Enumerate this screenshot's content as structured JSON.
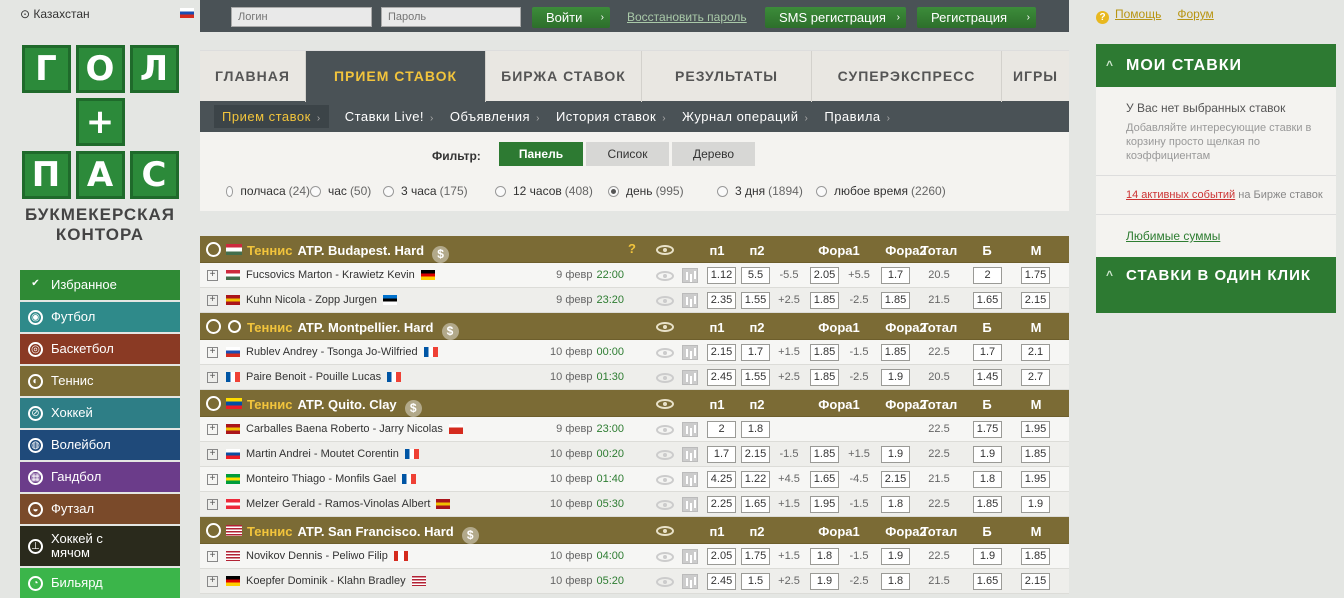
{
  "topbar": {
    "location": "⊙ Казахстан",
    "login_placeholder": "Логин",
    "password_placeholder": "Пароль",
    "login_button": "Войти",
    "restore_link": "Восстановить пароль",
    "sms_button": "SMS регистрация",
    "register_button": "Регистрация",
    "help_link": "Помощь",
    "forum_link": "Форум",
    "arrow": "›"
  },
  "logo": {
    "row1": [
      "Г",
      "О",
      "Л"
    ],
    "row2": [
      "+"
    ],
    "row3": [
      "П",
      "А",
      "С"
    ],
    "caption1": "БУКМЕКЕРСКАЯ",
    "caption2": "КОНТОРА"
  },
  "sports": [
    {
      "label": "Избранное",
      "icon": "✔",
      "color": "#2f8a35"
    },
    {
      "label": "Футбол",
      "icon": "◉",
      "color": "#2f8a8a"
    },
    {
      "label": "Баскетбол",
      "icon": "◎",
      "color": "#8a3a24"
    },
    {
      "label": "Теннис",
      "icon": "◐",
      "color": "#7b6b35"
    },
    {
      "label": "Хоккей",
      "icon": "⊘",
      "color": "#2e7e86"
    },
    {
      "label": "Волейбол",
      "icon": "◍",
      "color": "#1f4a7a"
    },
    {
      "label": "Гандбол",
      "icon": "▦",
      "color": "#6b3c8a"
    },
    {
      "label": "Футзал",
      "icon": "◒",
      "color": "#7a4a2a"
    },
    {
      "label": "Хоккей с мячом",
      "icon": "⊥",
      "color": "#2a2a1c"
    },
    {
      "label": "Бильярд",
      "icon": "◔",
      "color": "#3bb54a"
    }
  ],
  "tabs": [
    "ГЛАВНАЯ",
    "ПРИЕМ СТАВОК",
    "БИРЖА СТАВОК",
    "РЕЗУЛЬТАТЫ",
    "СУПЕРЭКСПРЕСС",
    "ИГРЫ"
  ],
  "subnav": [
    "Прием ставок",
    "Ставки Live!",
    "Объявления",
    "История ставок",
    "Журнал операций",
    "Правила"
  ],
  "filter": {
    "label": "Фильтр:",
    "views": [
      "Панель",
      "Список",
      "Дерево"
    ],
    "periods": [
      {
        "label": "полчаса",
        "count": "(24)"
      },
      {
        "label": "час",
        "count": "(50)"
      },
      {
        "label": "3 часа",
        "count": "(175)"
      },
      {
        "label": "12 часов",
        "count": "(408)"
      },
      {
        "label": "день",
        "count": "(995)",
        "selected": true
      },
      {
        "label": "3 дня",
        "count": "(1894)"
      },
      {
        "label": "любое время",
        "count": "(2260)"
      }
    ]
  },
  "columns": [
    "п1",
    "п2",
    "Фора1",
    "Фора2",
    "Тотал",
    "Б",
    "М"
  ],
  "question_mark": "?",
  "dollar": "$",
  "plus": "+",
  "sport_name": "Теннис",
  "groups": [
    {
      "title": "ATP. Budapest. Hard",
      "flag": [
        "#cd2a3e",
        "#fff",
        "#436f4d"
      ],
      "has_q": true,
      "events": [
        {
          "teams": "Fucsovics Marton - Krawietz Kevin",
          "date": "9 февр",
          "time": "22:00",
          "p1": "1.12",
          "p2": "5.5",
          "h1": "-5.5",
          "k1": "2.05",
          "h2": "+5.5",
          "k2": "1.7",
          "total": "20.5",
          "over": "2",
          "under": "1.75",
          "f1": [
            "#cd2a3e",
            "#fff",
            "#436f4d"
          ],
          "f2": [
            "#000",
            "#dd0000",
            "#ffce00"
          ]
        },
        {
          "teams": "Kuhn Nicola - Zopp Jurgen",
          "date": "9 февр",
          "time": "23:20",
          "p1": "2.35",
          "p2": "1.55",
          "h1": "+2.5",
          "k1": "1.85",
          "h2": "-2.5",
          "k2": "1.85",
          "total": "21.5",
          "over": "1.65",
          "under": "2.15",
          "f1": [
            "#aa151b",
            "#f1bf00",
            "#aa151b"
          ],
          "f2": [
            "#0072ce",
            "#000",
            "#fff"
          ]
        }
      ]
    },
    {
      "title": "ATP. Montpellier. Hard",
      "flag": "globe",
      "has_q": false,
      "events": [
        {
          "teams": "Rublev Andrey - Tsonga Jo-Wilfried",
          "date": "10 февр",
          "time": "00:00",
          "p1": "2.15",
          "p2": "1.7",
          "h1": "+1.5",
          "k1": "1.85",
          "h2": "-1.5",
          "k2": "1.85",
          "total": "22.5",
          "over": "1.7",
          "under": "2.1",
          "f1": [
            "#fff",
            "#1a4db3",
            "#d52b1e"
          ],
          "f2": "fr"
        },
        {
          "teams": "Paire Benoit - Pouille Lucas",
          "date": "10 февр",
          "time": "01:30",
          "p1": "2.45",
          "p2": "1.55",
          "h1": "+2.5",
          "k1": "1.85",
          "h2": "-2.5",
          "k2": "1.9",
          "total": "20.5",
          "over": "1.45",
          "under": "2.7",
          "f1": "fr",
          "f2": "fr"
        }
      ]
    },
    {
      "title": "ATP. Quito. Clay",
      "flag": [
        "#ffdd00",
        "#034ea2",
        "#ed1c24"
      ],
      "has_q": false,
      "events": [
        {
          "teams": "Carballes Baena Roberto - Jarry Nicolas",
          "date": "9 февр",
          "time": "23:00",
          "p1": "2",
          "p2": "1.8",
          "h1": "",
          "k1": "",
          "h2": "",
          "k2": "",
          "total": "22.5",
          "over": "1.75",
          "under": "1.95",
          "f1": [
            "#aa151b",
            "#f1bf00",
            "#aa151b"
          ],
          "f2": [
            "#fff",
            "#d52b1e",
            "#d52b1e"
          ]
        },
        {
          "teams": "Martin Andrei - Moutet Corentin",
          "date": "10 февр",
          "time": "00:20",
          "p1": "1.7",
          "p2": "2.15",
          "h1": "-1.5",
          "k1": "1.85",
          "h2": "+1.5",
          "k2": "1.9",
          "total": "22.5",
          "over": "1.9",
          "under": "1.85",
          "f1": [
            "#fff",
            "#0b4ea2",
            "#ee1c25"
          ],
          "f2": "fr"
        },
        {
          "teams": "Monteiro Thiago - Monfils Gael",
          "date": "10 февр",
          "time": "01:40",
          "p1": "4.25",
          "p2": "1.22",
          "h1": "+4.5",
          "k1": "1.65",
          "h2": "-4.5",
          "k2": "2.15",
          "total": "21.5",
          "over": "1.8",
          "under": "1.95",
          "f1": [
            "#009c3b",
            "#ffdf00",
            "#009c3b"
          ],
          "f2": "fr"
        },
        {
          "teams": "Melzer Gerald - Ramos-Vinolas Albert",
          "date": "10 февр",
          "time": "05:30",
          "p1": "2.25",
          "p2": "1.65",
          "h1": "+1.5",
          "k1": "1.95",
          "h2": "-1.5",
          "k2": "1.8",
          "total": "22.5",
          "over": "1.85",
          "under": "1.9",
          "f1": [
            "#ed2939",
            "#fff",
            "#ed2939"
          ],
          "f2": [
            "#aa151b",
            "#f1bf00",
            "#aa151b"
          ]
        }
      ]
    },
    {
      "title": "ATP. San Francisco. Hard",
      "flag": "us",
      "has_q": false,
      "events": [
        {
          "teams": "Novikov Dennis - Peliwo Filip",
          "date": "10 февр",
          "time": "04:00",
          "p1": "2.05",
          "p2": "1.75",
          "h1": "+1.5",
          "k1": "1.8",
          "h2": "-1.5",
          "k2": "1.9",
          "total": "22.5",
          "over": "1.9",
          "under": "1.85",
          "f1": "us",
          "f2": "ca"
        },
        {
          "teams": "Koepfer Dominik - Klahn Bradley",
          "date": "10 февр",
          "time": "05:20",
          "p1": "2.45",
          "p2": "1.5",
          "h1": "+2.5",
          "k1": "1.9",
          "h2": "-2.5",
          "k2": "1.8",
          "total": "21.5",
          "over": "1.65",
          "under": "2.15",
          "f1": [
            "#000",
            "#dd0000",
            "#ffce00"
          ],
          "f2": "us"
        }
      ]
    }
  ],
  "right": {
    "my_bets_title": "МОИ СТАВКИ",
    "no_bets": "У Вас нет выбранных ставок",
    "hint": "Добавляйте интересующие ставки в корзину просто щелкая по коэффициентам",
    "active_link": "14 активных событий",
    "active_rest": " на Бирже ставок",
    "favorite_sums": "Любимые суммы",
    "one_click_title": "СТАВКИ В ОДИН КЛИК",
    "chevron": "^"
  }
}
